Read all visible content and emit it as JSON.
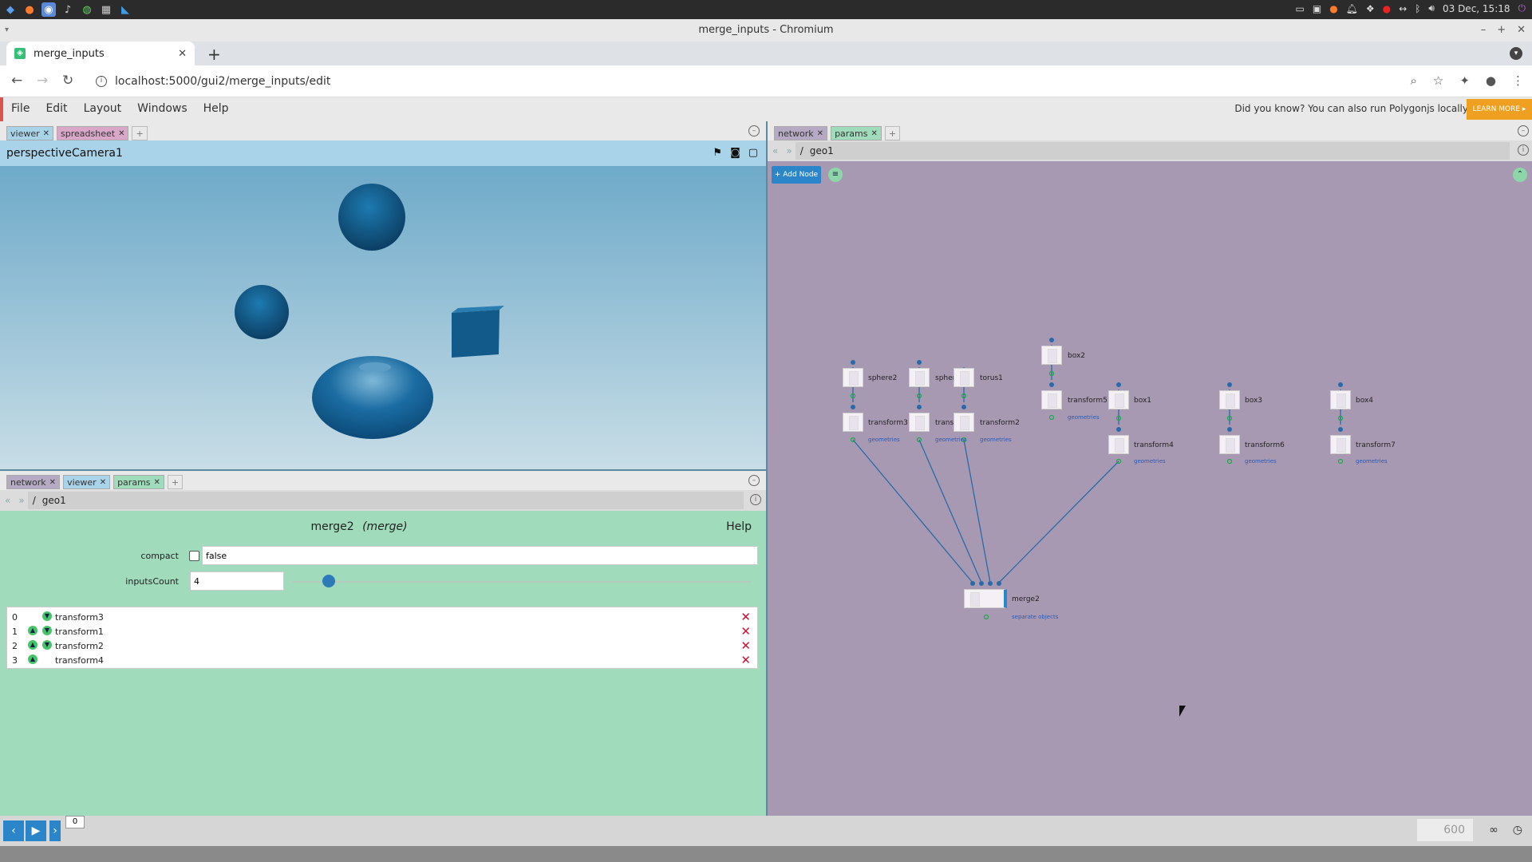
{
  "os": {
    "clock": "03 Dec, 15:18",
    "icons_left": [
      "menu-icon",
      "firefox-icon",
      "chromium-icon",
      "audio-icon",
      "terminal-icon",
      "files-icon",
      "vscode-icon"
    ],
    "icons_right": [
      "folder-icon",
      "terminal-icon",
      "firefox-icon",
      "bell-icon",
      "dropbox-icon",
      "record-icon",
      "network-icon",
      "bluetooth-icon",
      "volume-icon"
    ]
  },
  "browser": {
    "window_title": "merge_inputs - Chromium",
    "tab_title": "merge_inputs",
    "url": "localhost:5000/gui2/merge_inputs/edit"
  },
  "menubar": {
    "items": [
      "File",
      "Edit",
      "Layout",
      "Windows",
      "Help"
    ],
    "tip": "Did you know? You can also run Polygonjs locally",
    "learn_more": "LEARN MORE ▸"
  },
  "left_top": {
    "tabs": [
      "viewer",
      "spreadsheet"
    ],
    "camera_name": "perspectiveCamera1"
  },
  "left_bottom": {
    "tabs": [
      "network",
      "viewer",
      "params"
    ],
    "path_root": "/",
    "path": "geo1",
    "node_name": "merge2",
    "node_type": "(merge)",
    "help_label": "Help",
    "params": {
      "compact_label": "compact",
      "compact_value": "false",
      "inputs_count_label": "inputsCount",
      "inputs_count_value": "4",
      "inputs_count_slider_fraction": 0.08
    },
    "inputs": [
      {
        "index": "0",
        "name": "transform3"
      },
      {
        "index": "1",
        "name": "transform1"
      },
      {
        "index": "2",
        "name": "transform2"
      },
      {
        "index": "3",
        "name": "transform4"
      }
    ]
  },
  "right": {
    "tabs": [
      "network",
      "params"
    ],
    "path_root": "/",
    "path": "geo1",
    "add_node_label": "+ Add Node",
    "nodes": [
      {
        "name": "box2",
        "sub": ""
      },
      {
        "name": "sphere2",
        "sub": ""
      },
      {
        "name": "spher",
        "sub": ""
      },
      {
        "name": "torus1",
        "sub": ""
      },
      {
        "name": "transform5",
        "sub": "geometries"
      },
      {
        "name": "box1",
        "sub": ""
      },
      {
        "name": "box3",
        "sub": ""
      },
      {
        "name": "box4",
        "sub": ""
      },
      {
        "name": "transform3",
        "sub": "geometries"
      },
      {
        "name": "transf",
        "sub": "geometries"
      },
      {
        "name": "transform2",
        "sub": "geometries"
      },
      {
        "name": "transform4",
        "sub": "geometries"
      },
      {
        "name": "transform6",
        "sub": "geometries"
      },
      {
        "name": "transform7",
        "sub": "geometries"
      },
      {
        "name": "merge2",
        "sub": "separate objects"
      }
    ]
  },
  "timeline": {
    "current_frame": "0",
    "end_frame": "600"
  },
  "colors": {
    "params_bg": "#a0dcbc",
    "network_bg": "#a899b3",
    "viewer_header": "#a8d3e8",
    "accent": "#2a86c8",
    "delete": "#d01030"
  }
}
